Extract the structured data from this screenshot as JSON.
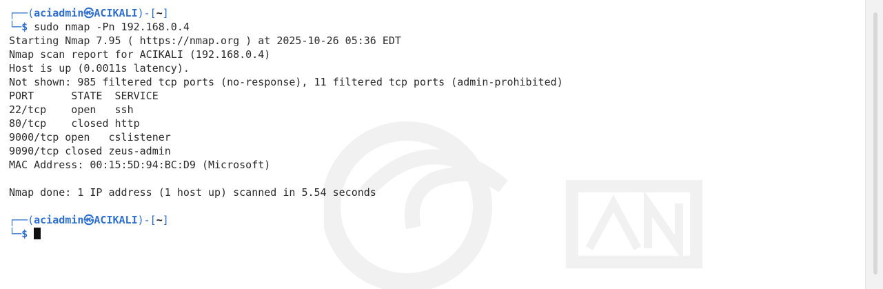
{
  "prompt": {
    "user": "aciadmin",
    "host": "ACIKALI",
    "dir": "~",
    "symbol": "$"
  },
  "command": "sudo nmap -Pn 192.168.0.4",
  "output": {
    "start": "Starting Nmap 7.95 ( https://nmap.org ) at 2025-10-26 05:36 EDT",
    "report": "Nmap scan report for ACIKALI (192.168.0.4)",
    "host_up": "Host is up (0.0011s latency).",
    "not_shown": "Not shown: 985 filtered tcp ports (no-response), 11 filtered tcp ports (admin-prohibited)",
    "header": "PORT      STATE  SERVICE",
    "ports": [
      "22/tcp    open   ssh",
      "80/tcp    closed http",
      "9000/tcp open   cslistener",
      "9090/tcp closed zeus-admin"
    ],
    "mac": "MAC Address: 00:15:5D:94:BC:D9 (Microsoft)",
    "done": "Nmap done: 1 IP address (1 host up) scanned in 5.54 seconds"
  }
}
